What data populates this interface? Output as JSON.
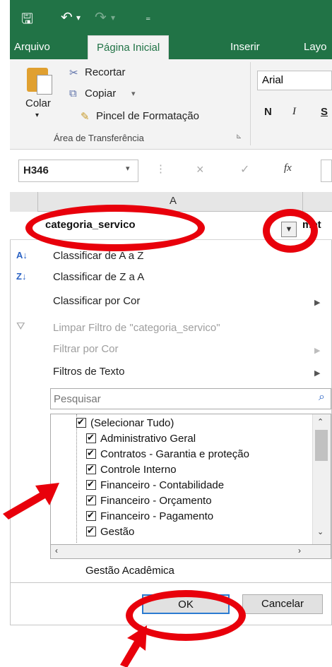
{
  "title_bar": {
    "save_icon": "save-icon",
    "undo_icon": "undo-icon",
    "redo_icon": "redo-icon",
    "customize_icon": "customize-icon"
  },
  "tabs": [
    "Arquivo",
    "Página Inicial",
    "Inserir",
    "Layo"
  ],
  "clipboard": {
    "paste": "Colar",
    "cut": "Recortar",
    "copy": "Copiar",
    "format_painter": "Pincel de Formatação",
    "group_label": "Área de Transferência"
  },
  "font": {
    "name": "Arial",
    "bold": "N",
    "italic": "I",
    "underline": "S"
  },
  "formula_bar": {
    "name_box": "H346",
    "fx": "fx"
  },
  "column_header": "A",
  "header_cell": {
    "text": "categoria_servico",
    "next_col": "met"
  },
  "menu": {
    "sort_asc": "Classificar de A a Z",
    "sort_desc": "Classificar de Z a A",
    "sort_color": "Classificar por Cor",
    "clear_filter": "Limpar Filtro de \"categoria_servico\"",
    "filter_color": "Filtrar por Cor",
    "text_filters": "Filtros de Texto"
  },
  "search": {
    "placeholder": "Pesquisar"
  },
  "list_items": [
    "(Selecionar Tudo)",
    "Administrativo Geral",
    "Contratos - Garantia e proteção",
    "Controle Interno",
    "Financeiro - Contabilidade",
    "Financeiro - Orçamento",
    "Financeiro - Pagamento",
    "Gestão",
    "Gestão Acadêmica"
  ],
  "buttons": {
    "ok": "OK",
    "cancel": "Cancelar"
  },
  "colors": {
    "excel_green": "#217346",
    "highlight_red": "#e8000b"
  }
}
